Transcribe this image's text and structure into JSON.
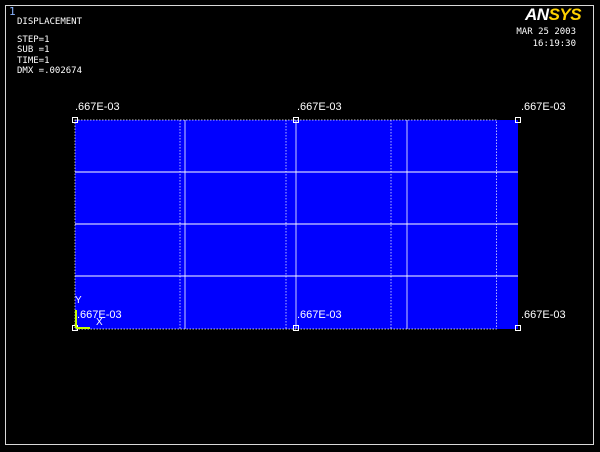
{
  "window_number": "1",
  "result_title": "DISPLACEMENT",
  "step": "STEP=1",
  "substep": "SUB =1",
  "time": "TIME=1",
  "dmx": "DMX =.002674",
  "brand": {
    "a": "AN",
    "b": "SYS"
  },
  "date": "MAR 25 2003",
  "clock": "16:19:30",
  "colors": {
    "fill": "#0000ff",
    "grid": "#ffffff",
    "background": "#000000",
    "brand_accent": "#ffd200",
    "triad": "#c8ff00"
  },
  "node_labels": {
    "top_left": ".667E-03",
    "top_mid": ".667E-03",
    "top_right": ".667E-03",
    "bottom_left": ".667E-03",
    "bottom_mid": ".667E-03",
    "bottom_right": ".667E-03"
  },
  "axis": {
    "y": "Y",
    "x": "X"
  }
}
